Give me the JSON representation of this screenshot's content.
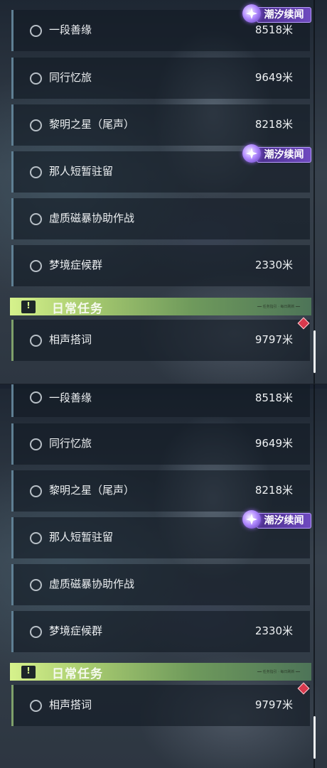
{
  "badge_label": "潮汐续闻",
  "daily_header": {
    "title": "日常任务",
    "icon": "exclamation-icon",
    "note": "━━ 任务指引 · 每日刷新 ━━"
  },
  "quests": [
    {
      "name": "一段善缘",
      "distance": "8518米"
    },
    {
      "name": "同行忆旅",
      "distance": "9649米"
    },
    {
      "name": "黎明之星（尾声）",
      "distance": "8218米"
    },
    {
      "name": "那人短暂驻留",
      "distance": ""
    },
    {
      "name": "虚质磁暴协助作战",
      "distance": ""
    },
    {
      "name": "梦境症候群",
      "distance": "2330米"
    }
  ],
  "daily_quests": [
    {
      "name": "相声搭词",
      "distance": "9797米"
    }
  ],
  "colors": {
    "badge_purple": "#6f4ac0",
    "daily_green": "#a9cc70",
    "alert_red": "#d8394d"
  }
}
